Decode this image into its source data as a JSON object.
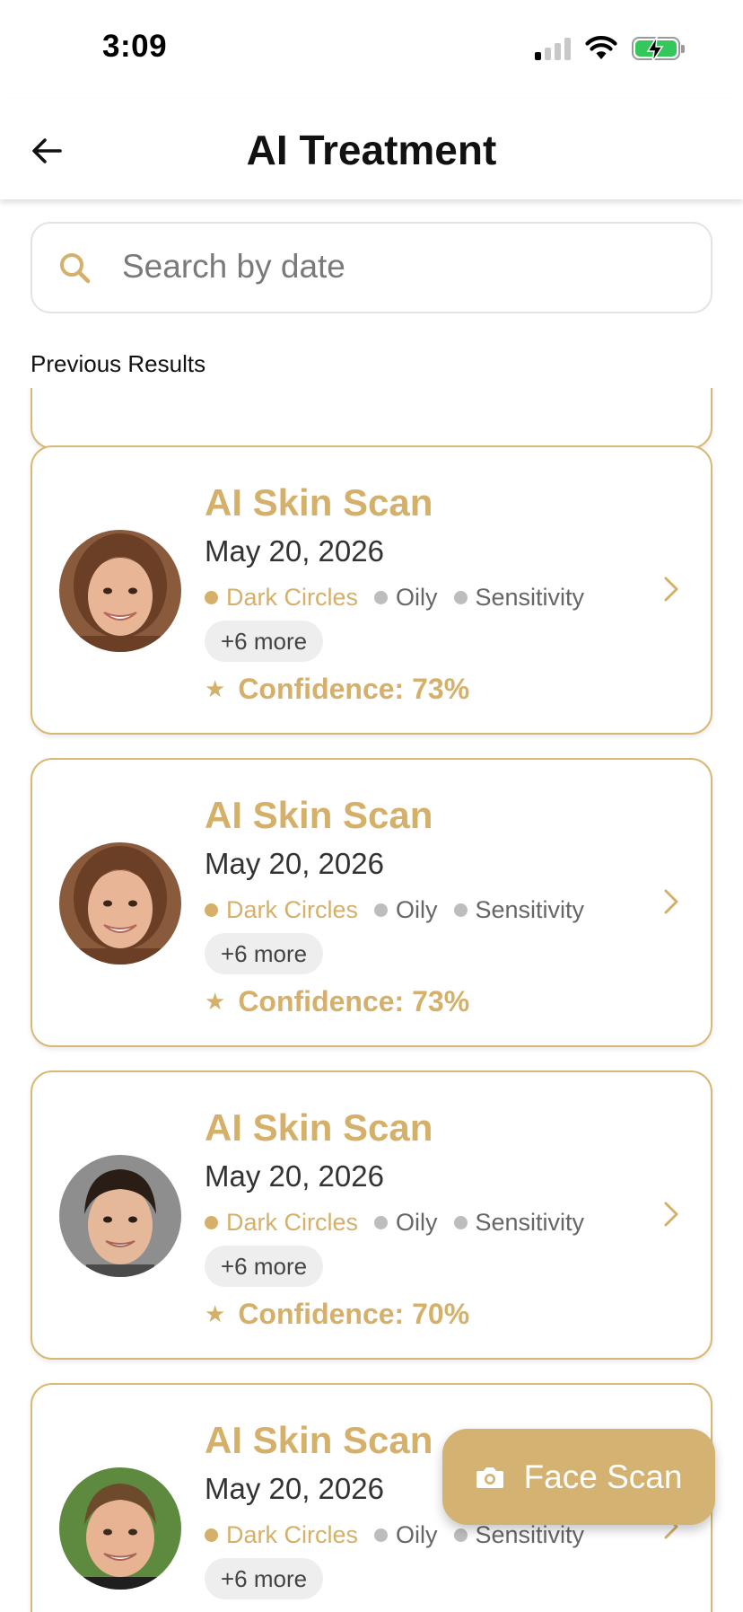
{
  "status_bar": {
    "time": "3:09"
  },
  "header": {
    "title": "AI Treatment",
    "back_icon": "arrow-left-icon"
  },
  "search": {
    "placeholder": "Search by date",
    "value": "",
    "icon": "search-icon"
  },
  "section": {
    "label": "Previous Results"
  },
  "results": [
    {
      "title": "AI Skin Scan",
      "date": "May 20, 2026",
      "tags": [
        {
          "label": "Dark Circles",
          "primary": true
        },
        {
          "label": "Oily",
          "primary": false
        },
        {
          "label": "Sensitivity",
          "primary": false
        }
      ],
      "more": "+6 more",
      "confidence": "Confidence: 73%"
    },
    {
      "title": "AI Skin Scan",
      "date": "May 20, 2026",
      "tags": [
        {
          "label": "Dark Circles",
          "primary": true
        },
        {
          "label": "Oily",
          "primary": false
        },
        {
          "label": "Sensitivity",
          "primary": false
        }
      ],
      "more": "+6 more",
      "confidence": "Confidence: 73%"
    },
    {
      "title": "AI Skin Scan",
      "date": "May 20, 2026",
      "tags": [
        {
          "label": "Dark Circles",
          "primary": true
        },
        {
          "label": "Oily",
          "primary": false
        },
        {
          "label": "Sensitivity",
          "primary": false
        }
      ],
      "more": "+6 more",
      "confidence": "Confidence: 70%"
    },
    {
      "title": "AI Skin Scan",
      "date": "May 20, 2026",
      "tags": [
        {
          "label": "Dark Circles",
          "primary": true
        },
        {
          "label": "Oily",
          "primary": false
        },
        {
          "label": "Sensitivity",
          "primary": false
        }
      ],
      "more": "+6 more",
      "confidence": ""
    }
  ],
  "fab": {
    "label": "Face Scan",
    "icon": "camera-icon"
  },
  "colors": {
    "accent": "#d4b06a",
    "card_border": "#d9b874",
    "fab_bg": "#d4b272",
    "tag_gray": "#bdbdbd",
    "battery": "#34c759"
  }
}
